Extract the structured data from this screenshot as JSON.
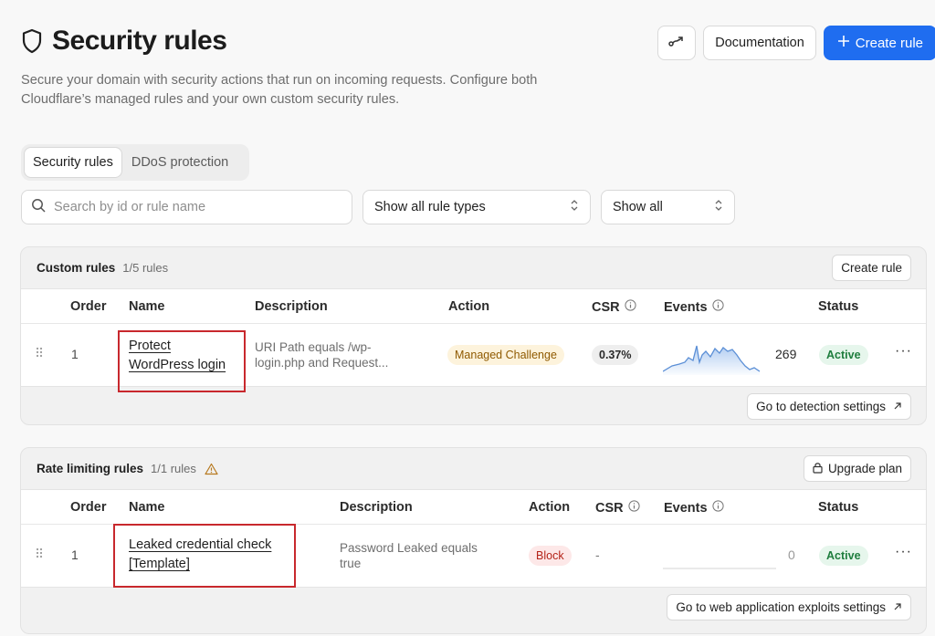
{
  "header": {
    "title": "Security rules",
    "subtitle": "Secure your domain with security actions that run on incoming requests. Configure both Cloudflare’s managed rules and your own custom security rules.",
    "documentation_label": "Documentation",
    "create_rule_label": "Create rule"
  },
  "tabs": [
    {
      "label": "Security rules",
      "active": true
    },
    {
      "label": "DDoS protection",
      "active": false
    }
  ],
  "filters": {
    "search_placeholder": "Search by id or rule name",
    "rule_type_value": "Show all rule types",
    "show_value": "Show all"
  },
  "custom_rules": {
    "title": "Custom rules",
    "count": "1/5 rules",
    "create_label": "Create rule",
    "columns": [
      "Order",
      "Name",
      "Description",
      "Action",
      "CSR",
      "Events",
      "Status"
    ],
    "rows": [
      {
        "order": "1",
        "name": "Protect WordPress login",
        "description": "URI Path equals /wp-login.php and Request...",
        "action": "Managed Challenge",
        "csr": "0.37%",
        "events": "269",
        "status": "Active"
      }
    ],
    "footer_label": "Go to detection settings"
  },
  "rate_limiting_rules": {
    "title": "Rate limiting rules",
    "count": "1/1 rules",
    "upgrade_label": "Upgrade plan",
    "columns": [
      "Order",
      "Name",
      "Description",
      "Action",
      "CSR",
      "Events",
      "Status"
    ],
    "rows": [
      {
        "order": "1",
        "name": "Leaked credential check [Template]",
        "description": "Password Leaked equals true",
        "action": "Block",
        "csr": "-",
        "events": "0",
        "status": "Active"
      }
    ],
    "footer_label": "Go to web application exploits settings"
  },
  "colors": {
    "primary": "#1f6df0",
    "highlight": "#c8282d",
    "active_green": "#1e7d3d",
    "block_red": "#b42318",
    "challenge_amber": "#8f5a00",
    "sparkline": "#5b8fd6"
  },
  "icons": {
    "title": "shield-icon",
    "header_icon_button": "route-icon",
    "create": "plus-icon",
    "search": "search-icon",
    "select": "chevron-up-down-icon",
    "info": "info-icon",
    "warning": "warning-icon",
    "lock": "lock-icon",
    "external": "arrow-up-right-icon",
    "drag": "drag-handle-icon",
    "more": "more-icon"
  }
}
